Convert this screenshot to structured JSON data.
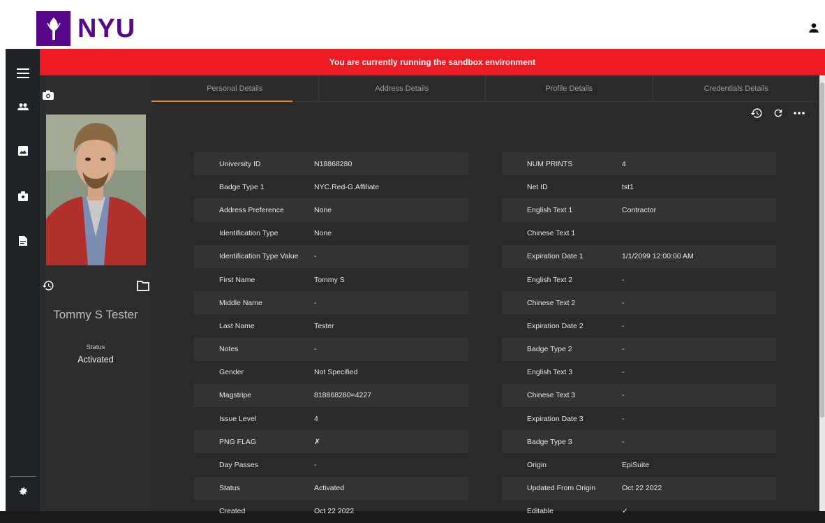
{
  "brand": {
    "name": "NYU",
    "color": "#57068c"
  },
  "banner": {
    "text": "You are currently running the sandbox environment"
  },
  "icons": {
    "user": "account-icon",
    "menu": "hamburger-menu-icon",
    "people": "people-icon",
    "photo": "image-icon",
    "badge": "badge-icon",
    "document": "document-icon",
    "settings": "gear-icon",
    "camera": "camera-icon",
    "history": "history-icon",
    "refresh": "refresh-icon",
    "more": "more-icon",
    "folder": "folder-icon"
  },
  "tabs": [
    {
      "label": "Personal Details",
      "active": true
    },
    {
      "label": "Address Details",
      "active": false
    },
    {
      "label": "Profile Details",
      "active": false
    },
    {
      "label": "Credentials Details",
      "active": false
    }
  ],
  "profile": {
    "name": "Tommy S Tester",
    "status_label": "Status",
    "status_value": "Activated"
  },
  "left_fields": [
    {
      "label": "University ID",
      "value": "N18868280"
    },
    {
      "label": "Badge Type 1",
      "value": "NYC.Red-G.Affiliate"
    },
    {
      "label": "Address Preference",
      "value": "None"
    },
    {
      "label": "Identification Type",
      "value": "None"
    },
    {
      "label": "Identification Type Value",
      "value": "-"
    },
    {
      "label": "First Name",
      "value": "Tommy S"
    },
    {
      "label": "Middle Name",
      "value": "-"
    },
    {
      "label": "Last Name",
      "value": "Tester"
    },
    {
      "label": "Notes",
      "value": "-"
    },
    {
      "label": "Gender",
      "value": "Not Specified"
    },
    {
      "label": "Magstripe",
      "value": "818868280=4227"
    },
    {
      "label": "Issue Level",
      "value": "4"
    },
    {
      "label": "PNG FLAG",
      "value": "✗"
    },
    {
      "label": "Day Passes",
      "value": "-"
    },
    {
      "label": "Status",
      "value": "Activated"
    },
    {
      "label": "Created",
      "value": "Oct 22 2022"
    }
  ],
  "right_fields": [
    {
      "label": "NUM PRINTS",
      "value": "4"
    },
    {
      "label": "Net ID",
      "value": "tst1"
    },
    {
      "label": "English Text 1",
      "value": "Contractor"
    },
    {
      "label": "Chinese Text 1",
      "value": ""
    },
    {
      "label": "Expiration Date 1",
      "value": "1/1/2099 12:00:00 AM"
    },
    {
      "label": "English Text 2",
      "value": "-"
    },
    {
      "label": "Chinese Text 2",
      "value": "-"
    },
    {
      "label": "Expiration Date 2",
      "value": "-"
    },
    {
      "label": "Badge Type 2",
      "value": "-"
    },
    {
      "label": "English Text 3",
      "value": "-"
    },
    {
      "label": "Chinese Text 3",
      "value": "-"
    },
    {
      "label": "Expiration Date 3",
      "value": "-"
    },
    {
      "label": "Badge Type 3",
      "value": "-"
    },
    {
      "label": "Origin",
      "value": "EpiSuite"
    },
    {
      "label": "Updated From Origin",
      "value": "Oct 22 2022"
    },
    {
      "label": "Editable",
      "value": "✓"
    }
  ]
}
